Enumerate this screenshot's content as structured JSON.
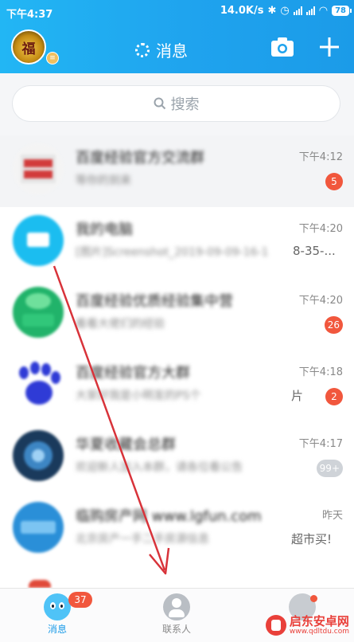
{
  "status_bar": {
    "time": "下午4:37",
    "net_speed": "14.0K/s",
    "battery": "78"
  },
  "header": {
    "avatar_char": "福",
    "title": "消息"
  },
  "search": {
    "placeholder": "搜索"
  },
  "chats": [
    {
      "name": "百度经验官方交流群",
      "preview": "等你的到来",
      "time": "下午4:12",
      "unread": "5"
    },
    {
      "name": "我的电脑",
      "preview": "[图片]Screenshot_2019-09-09-16-1",
      "preview_tail": "8-35-...",
      "time": "下午4:20"
    },
    {
      "name": "百度经验优质经验集中营",
      "preview": "看看大佬们的经验",
      "time": "下午4:20",
      "unread": "26"
    },
    {
      "name": "百度经验官方大群",
      "preview": "大家好我是小明发的PS个",
      "preview_tail": "片",
      "time": "下午4:18",
      "unread": "2"
    },
    {
      "name": "华夏收藏会总群",
      "preview": "欢迎新人加入本群，请各位看公告",
      "time": "下午4:17",
      "unread": "99+"
    },
    {
      "name": "临购房产网 www.lgfun.com",
      "preview": "北京房产一手二手房源信息",
      "preview_tail": "超市买!",
      "time": "昨天"
    }
  ],
  "tabbar": {
    "messages_label": "消息",
    "messages_badge": "37",
    "contacts_label": "联系人"
  },
  "watermark": {
    "brand": "启东安卓网",
    "url": "www.qdltdu.com"
  },
  "colors": {
    "header_blue": "#1b9be8",
    "badge_red": "#f1573d",
    "arrow_red": "#d8333a"
  }
}
